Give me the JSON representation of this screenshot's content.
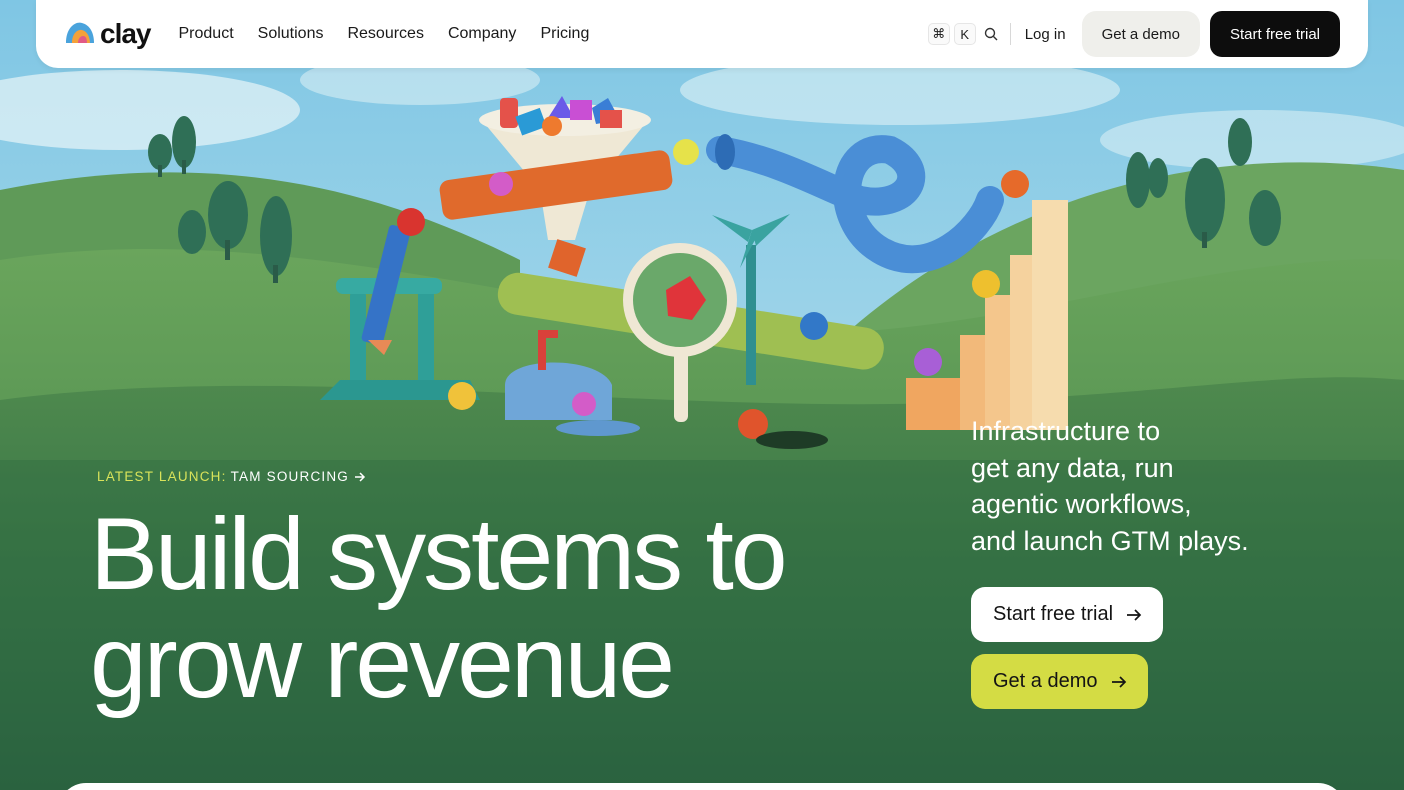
{
  "nav": {
    "logo_text": "clay",
    "links": [
      "Product",
      "Solutions",
      "Resources",
      "Company",
      "Pricing"
    ],
    "kbd_cmd": "⌘",
    "kbd_k": "K",
    "login": "Log in",
    "demo": "Get a demo",
    "trial": "Start free trial"
  },
  "hero": {
    "launch_key": "LATEST LAUNCH:",
    "launch_value": "TAM SOURCING",
    "headline_line1": "Build systems to",
    "headline_line2": "grow revenue",
    "tagline_line1": "Infrastructure to",
    "tagline_line2": "get any data, run",
    "tagline_line3": "agentic workflows,",
    "tagline_line4": "and launch GTM plays.",
    "trial": "Start free trial",
    "demo": "Get a demo"
  },
  "colors": {
    "accent": "#d4dc44",
    "dark": "#0d0d0d",
    "grass": "#2f6b45",
    "sky": "#9fd3ea"
  },
  "icons": [
    "clay-logo-icon",
    "search-icon",
    "arrow-right-icon"
  ]
}
